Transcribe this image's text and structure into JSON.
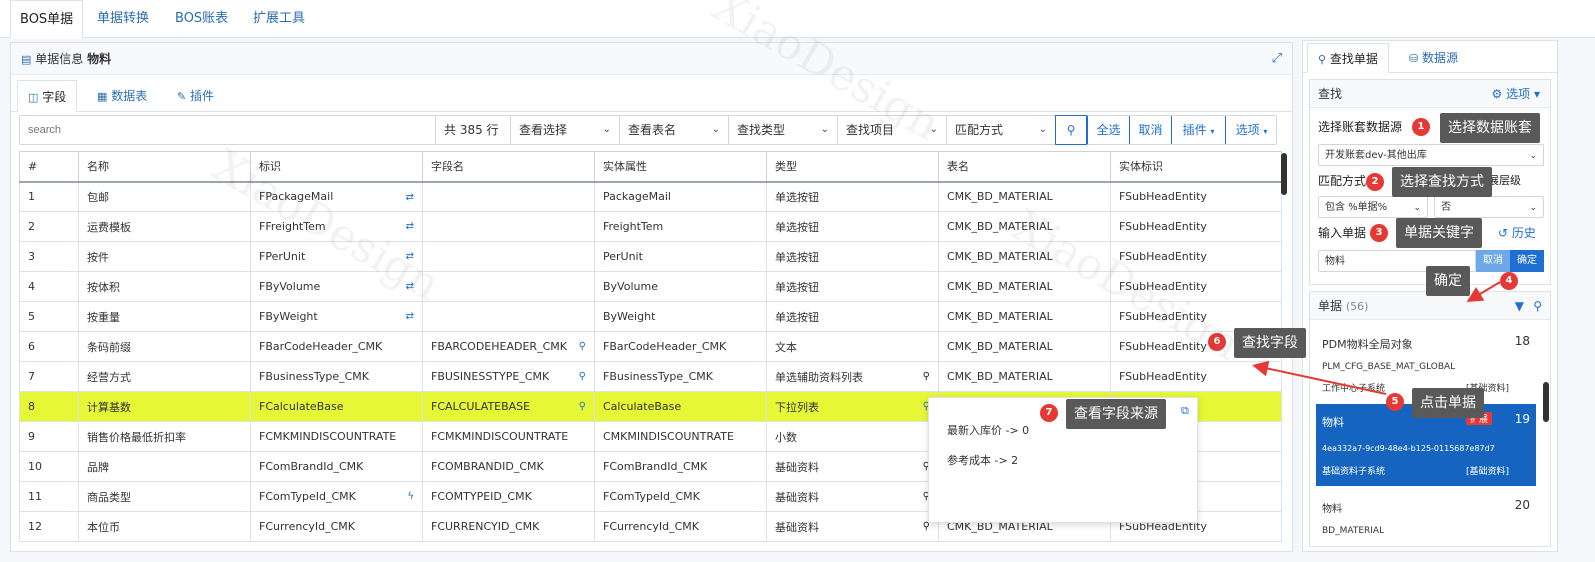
{
  "top_tabs": [
    "BOS单据",
    "单据转换",
    "BOS账表",
    "扩展工具"
  ],
  "panel": {
    "title_prefix": "单据信息",
    "title_bold": "物料",
    "expand_icon": "expand-icon"
  },
  "sub_tabs": [
    "字段",
    "数据表",
    "插件"
  ],
  "toolbar": {
    "search_placeholder": "search",
    "count": "共 385 行",
    "dropdowns": [
      "查看选择",
      "查看表名",
      "查找类型",
      "查找项目",
      "匹配方式"
    ],
    "select_all": "全选",
    "cancel": "取消",
    "plugin": "插件",
    "options": "选项"
  },
  "table": {
    "columns": [
      "#",
      "名称",
      "标识",
      "字段名",
      "实体属性",
      "类型",
      "表名",
      "实体标识"
    ],
    "rows": [
      [
        "1",
        "包邮",
        "FPackageMail",
        "",
        "PackageMail",
        "单选按钮",
        "CMK_BD_MATERIAL",
        "FSubHeadEntity"
      ],
      [
        "2",
        "运费模板",
        "FFreightTem",
        "",
        "FreightTem",
        "单选按钮",
        "CMK_BD_MATERIAL",
        "FSubHeadEntity"
      ],
      [
        "3",
        "按件",
        "FPerUnit",
        "",
        "PerUnit",
        "单选按钮",
        "CMK_BD_MATERIAL",
        "FSubHeadEntity"
      ],
      [
        "4",
        "按体积",
        "FByVolume",
        "",
        "ByVolume",
        "单选按钮",
        "CMK_BD_MATERIAL",
        "FSubHeadEntity"
      ],
      [
        "5",
        "按重量",
        "FByWeight",
        "",
        "ByWeight",
        "单选按钮",
        "CMK_BD_MATERIAL",
        "FSubHeadEntity"
      ],
      [
        "6",
        "条码前缀",
        "FBarCodeHeader_CMK",
        "FBARCODEHEADER_CMK",
        "FBarCodeHeader_CMK",
        "文本",
        "CMK_BD_MATERIAL",
        "FSubHeadEntity"
      ],
      [
        "7",
        "经营方式",
        "FBusinessType_CMK",
        "FBUSINESSTYPE_CMK",
        "FBusinessType_CMK",
        "单选辅助资料列表",
        "CMK_BD_MATERIAL",
        "FSubHeadEntity"
      ],
      [
        "8",
        "计算基数",
        "FCalculateBase",
        "FCALCULATEBASE",
        "CalculateBase",
        "下拉列表",
        "",
        ""
      ],
      [
        "9",
        "销售价格最低折扣率",
        "FCMKMINDISCOUNTRATE",
        "FCMKMINDISCOUNTRATE",
        "CMKMINDISCOUNTRATE",
        "小数",
        "",
        ""
      ],
      [
        "10",
        "品牌",
        "FComBrandId_CMK",
        "FCOMBRANDID_CMK",
        "FComBrandId_CMK",
        "基础资料",
        "",
        ""
      ],
      [
        "11",
        "商品类型",
        "FComTypeId_CMK",
        "FCOMTYPEID_CMK",
        "FComTypeId_CMK",
        "基础资料",
        "",
        ""
      ],
      [
        "12",
        "本位币",
        "FCurrencyId_CMK",
        "FCURRENCYID_CMK",
        "FCurrencyId_CMK",
        "基础资料",
        "CMK_BD_MATERIAL",
        "FSubHeadEntity"
      ]
    ]
  },
  "popup": {
    "line1": "最新入库价 -> 0",
    "line2": "参考成本 -> 2"
  },
  "right": {
    "tabs": [
      "查找单据",
      "数据源"
    ],
    "find_title": "查找",
    "options": "选项",
    "datasource_label": "选择账套数据源",
    "datasource_value": "开发账套dev-其他出库",
    "match_label": "匹配方式",
    "match_value": "包含 %单据%",
    "hint": "只搜索扩展层级",
    "no_value": "否",
    "input_label": "输入单据",
    "history": "历史",
    "input_value": "物料",
    "cancel": "取消",
    "confirm": "确定",
    "list_title": "单据",
    "list_count": "(56)",
    "results": [
      {
        "name": "PDM物料全局对象",
        "count": "18",
        "key": "PLM_CFG_BASE_MAT_GLOBAL",
        "sub": "工作中心子系统",
        "tag": "[基础资料]"
      },
      {
        "name": "物料",
        "count": "19",
        "key": "4ea332a7-9cd9-48e4-b125-0115687e87d7",
        "sub": "基础资料子系统",
        "tag": "[基础资料]",
        "badge": "扩展"
      },
      {
        "name": "物料",
        "count": "20",
        "key": "BD_MATERIAL",
        "sub": "",
        "tag": ""
      }
    ]
  },
  "callouts": [
    {
      "n": "1",
      "text": "选择数据账套"
    },
    {
      "n": "2",
      "text": "选择查找方式"
    },
    {
      "n": "3",
      "text": "单据关键字"
    },
    {
      "n": "4",
      "text": "确定"
    },
    {
      "n": "5",
      "text": "点击单据"
    },
    {
      "n": "6",
      "text": "查找字段"
    },
    {
      "n": "7",
      "text": "查看字段来源"
    }
  ],
  "watermark": "XiaoDesign",
  "colors": {
    "accent": "#1f6fd1",
    "highlight_row": "#e6f736",
    "callout_bg": "#595959",
    "badge_red": "#e53935",
    "selected_result": "#1565c0"
  }
}
